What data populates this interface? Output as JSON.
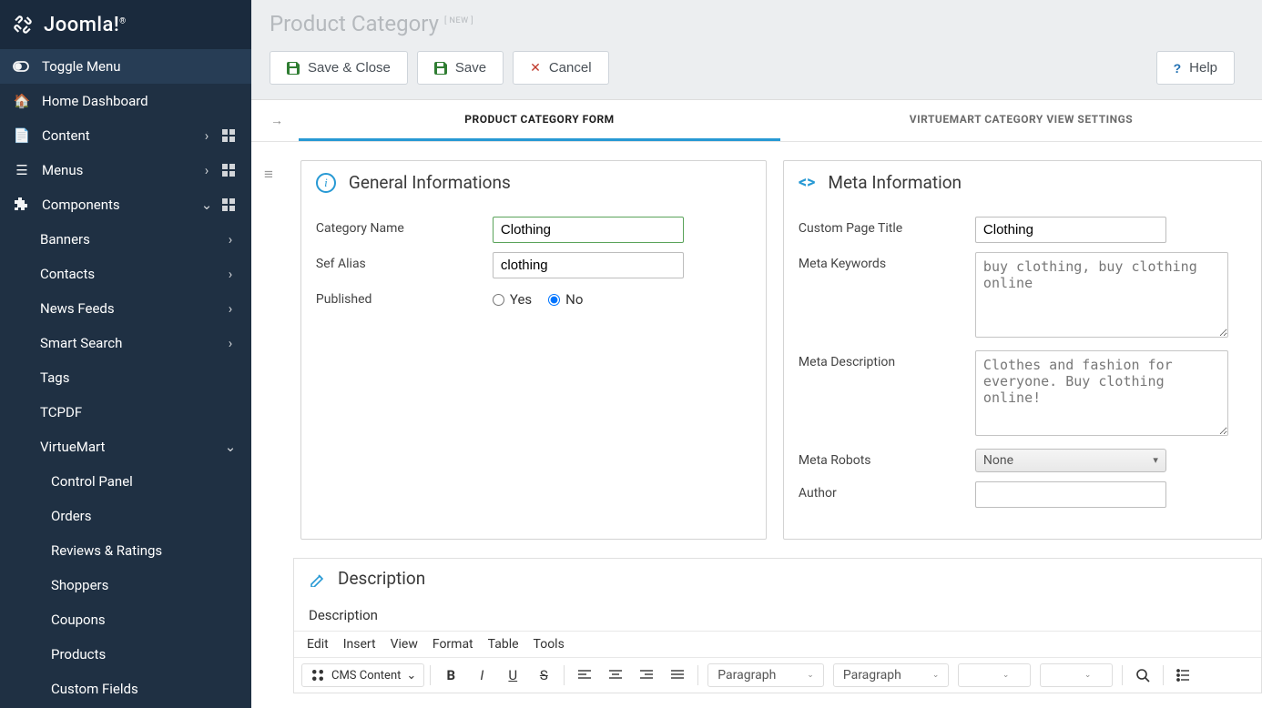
{
  "brand": {
    "name": "Joomla!"
  },
  "sidebar": {
    "toggle": "Toggle Menu",
    "home": "Home Dashboard",
    "content": "Content",
    "menus": "Menus",
    "components": "Components",
    "sub": {
      "banners": "Banners",
      "contacts": "Contacts",
      "newsfeeds": "News Feeds",
      "smartsearch": "Smart Search",
      "tags": "Tags",
      "tcpdf": "TCPDF",
      "virtuemart": "VirtueMart"
    },
    "vm": {
      "control_panel": "Control Panel",
      "orders": "Orders",
      "reviews": "Reviews & Ratings",
      "shoppers": "Shoppers",
      "coupons": "Coupons",
      "products": "Products",
      "custom_fields": "Custom Fields"
    }
  },
  "header": {
    "title": "Product Category",
    "badge": "[ NEW ]"
  },
  "toolbar": {
    "save_close": "Save & Close",
    "save": "Save",
    "cancel": "Cancel",
    "help": "Help"
  },
  "tabs": {
    "form": "PRODUCT CATEGORY FORM",
    "view": "VIRTUEMART CATEGORY VIEW SETTINGS"
  },
  "panels": {
    "general": {
      "title": "General Informations",
      "category_name_label": "Category Name",
      "category_name_value": "Clothing",
      "sef_alias_label": "Sef Alias",
      "sef_alias_value": "clothing",
      "published_label": "Published",
      "published_yes": "Yes",
      "published_no": "No",
      "published_selected": "No"
    },
    "meta": {
      "title": "Meta Information",
      "custom_title_label": "Custom Page Title",
      "custom_title_value": "Clothing",
      "keywords_label": "Meta Keywords",
      "keywords_value": "buy clothing, buy clothing online",
      "description_label": "Meta Description",
      "description_value": "Clothes and fashion for everyone. Buy clothing online!",
      "robots_label": "Meta Robots",
      "robots_value": "None",
      "author_label": "Author",
      "author_value": ""
    },
    "desc": {
      "title": "Description",
      "sub": "Description"
    }
  },
  "editor": {
    "menu": {
      "edit": "Edit",
      "insert": "Insert",
      "view": "View",
      "format": "Format",
      "table": "Table",
      "tools": "Tools"
    },
    "cms": "CMS Content",
    "para1": "Paragraph",
    "para2": "Paragraph"
  }
}
